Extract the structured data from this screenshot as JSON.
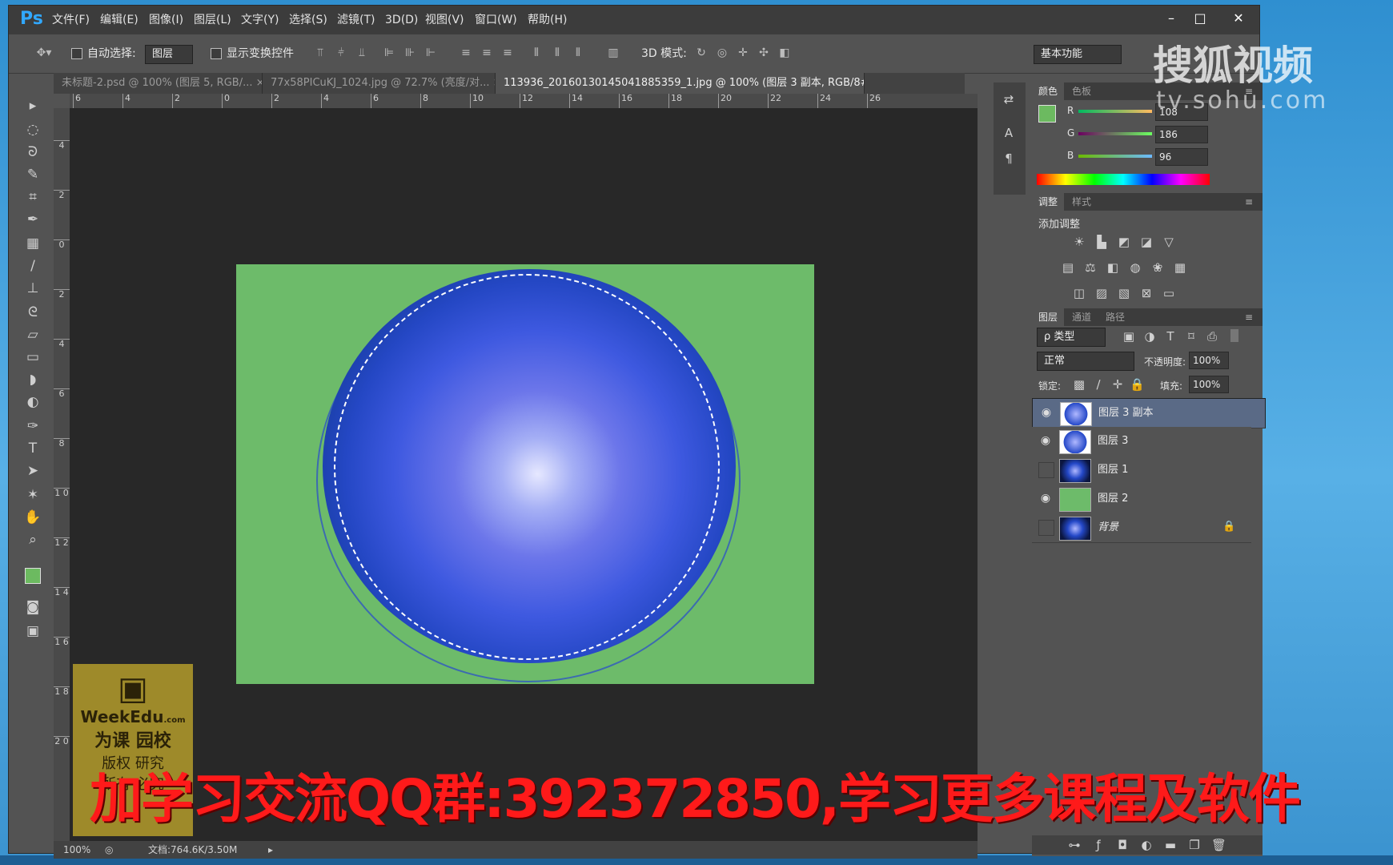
{
  "app": {
    "logo": "Ps"
  },
  "menu": [
    "文件(F)",
    "编辑(E)",
    "图像(I)",
    "图层(L)",
    "文字(Y)",
    "选择(S)",
    "滤镜(T)",
    "3D(D)",
    "视图(V)",
    "窗口(W)",
    "帮助(H)"
  ],
  "window_controls": {
    "minimize": "–",
    "maximize": "□",
    "close": "✕"
  },
  "options": {
    "auto_select_label": "自动选择:",
    "auto_select_value": "图层",
    "show_transform_label": "显示变换控件",
    "mode_3d_label": "3D 模式:",
    "workspace": "基本功能"
  },
  "tabs": [
    {
      "label": "未标题-2.psd @ 100% (图层 5, RGB/...",
      "close": "×"
    },
    {
      "label": "77x58PICuKJ_1024.jpg @ 72.7% (亮度/对...",
      "close": "×"
    },
    {
      "label": "113936_20160130145041885359_1.jpg @ 100% (图层 3 副本, RGB/8#) *",
      "close": "×"
    }
  ],
  "ruler_h": [
    "6",
    "4",
    "2",
    "0",
    "2",
    "4",
    "6",
    "8",
    "10",
    "12",
    "14",
    "16",
    "18",
    "20",
    "22",
    "24",
    "26"
  ],
  "ruler_v": [
    "4",
    "2",
    "0",
    "2",
    "4",
    "6",
    "8",
    "1 0",
    "1 2",
    "1 4",
    "1 6",
    "1 8",
    "2 0"
  ],
  "status": {
    "zoom": "100%",
    "doc": "文档:764.6K/3.50M"
  },
  "watermark": {
    "brand": "WeekEdu",
    "domain": ".com",
    "line1": "为课 园校",
    "line2": "版权 研究",
    "line3": "所有 必究"
  },
  "caption": "加学习交流QQ群:392372850,学习更多课程及软件",
  "sohu": {
    "name": "搜狐视频",
    "url": "tv.sohu.com"
  },
  "color_panel": {
    "tabs": [
      "颜色",
      "色板"
    ],
    "channels": [
      {
        "label": "R",
        "value": "108"
      },
      {
        "label": "G",
        "value": "186"
      },
      {
        "label": "B",
        "value": "96"
      }
    ],
    "foreground": "#6cba60"
  },
  "adjust_panel": {
    "tabs": [
      "调整",
      "样式"
    ],
    "title": "添加调整"
  },
  "layers_panel": {
    "tabs": [
      "图层",
      "通道",
      "路径"
    ],
    "filter": "ρ 类型",
    "blend_mode": "正常",
    "opacity_label": "不透明度:",
    "opacity": "100%",
    "lock_label": "锁定:",
    "fill_label": "填充:",
    "fill": "100%",
    "layers": [
      {
        "name": "图层 3 副本",
        "visible": true,
        "selected": true,
        "kind": "sphere"
      },
      {
        "name": "图层 3",
        "visible": true,
        "selected": false,
        "kind": "sphere"
      },
      {
        "name": "图层 1",
        "visible": false,
        "selected": false,
        "kind": "galaxy"
      },
      {
        "name": "图层 2",
        "visible": true,
        "selected": false,
        "kind": "green"
      },
      {
        "name": "背景",
        "visible": false,
        "selected": false,
        "kind": "galaxy",
        "locked": true
      }
    ]
  }
}
